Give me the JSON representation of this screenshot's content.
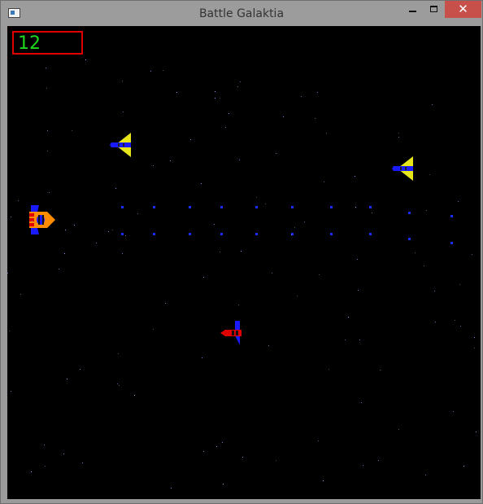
{
  "window": {
    "title": "Battle Galaktia",
    "icons": {
      "app": "app-window-icon",
      "minimize": "minimize-icon",
      "maximize": "maximize-icon",
      "close": "close-icon"
    },
    "close_glyph": "✕"
  },
  "hud": {
    "score": "12"
  },
  "colors": {
    "background": "#000000",
    "score_text": "#1ed81e",
    "score_border": "#e00000",
    "bullet": "#1a2cff",
    "enemy_wing": "#e6e61a",
    "enemy_body": "#1a1aff",
    "player_body": "#ff8c00",
    "player_wing": "#1a1aff",
    "rocket_body": "#e00000"
  },
  "sprites": {
    "player": "player-ship-icon",
    "enemy": "enemy-fighter-icon",
    "rocket": "red-rocket-icon"
  }
}
